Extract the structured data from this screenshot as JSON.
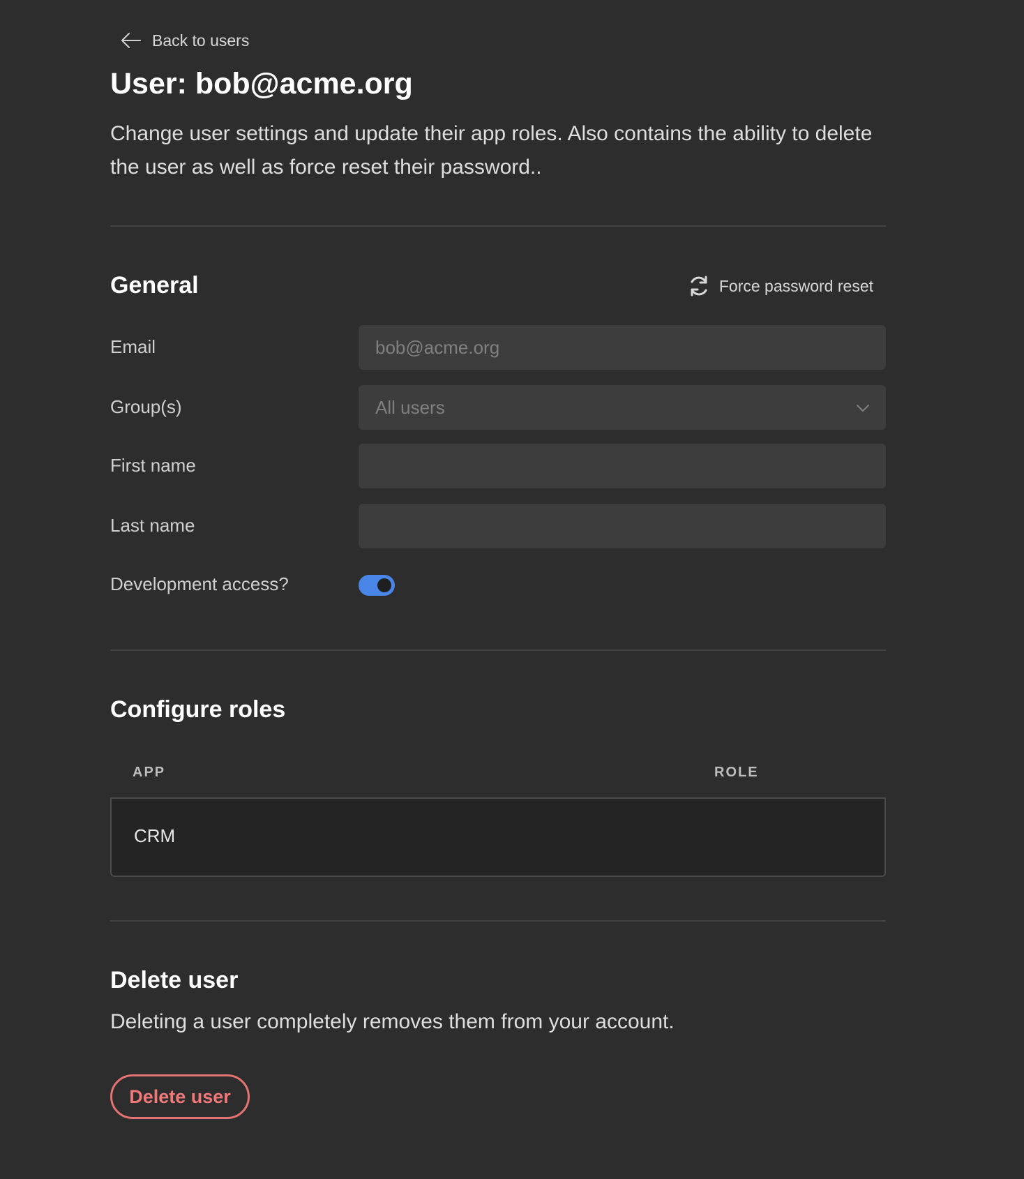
{
  "nav": {
    "back_label": "Back to users"
  },
  "header": {
    "title": "User: bob@acme.org",
    "description": "Change user settings and update their app roles. Also contains the ability to delete the user as well as force reset their password.."
  },
  "general": {
    "title": "General",
    "force_reset_label": "Force password reset",
    "fields": {
      "email": {
        "label": "Email",
        "value": "bob@acme.org"
      },
      "groups": {
        "label": "Group(s)",
        "value": "All users"
      },
      "first_name": {
        "label": "First name",
        "value": ""
      },
      "last_name": {
        "label": "Last name",
        "value": ""
      },
      "dev_access": {
        "label": "Development access?",
        "enabled": true
      }
    }
  },
  "roles": {
    "title": "Configure roles",
    "columns": [
      "APP",
      "ROLE"
    ],
    "rows": [
      {
        "app": "CRM",
        "role": ""
      }
    ]
  },
  "delete": {
    "title": "Delete user",
    "description": "Deleting a user completely removes them from your account.",
    "button_label": "Delete user"
  },
  "colors": {
    "background": "#2d2d2d",
    "input_bg": "#3d3d3d",
    "accent": "#4a86e8",
    "danger": "#e57373"
  },
  "icons": {
    "back": "arrow-left-icon",
    "reset": "refresh-icon",
    "select": "chevron-down-icon"
  }
}
